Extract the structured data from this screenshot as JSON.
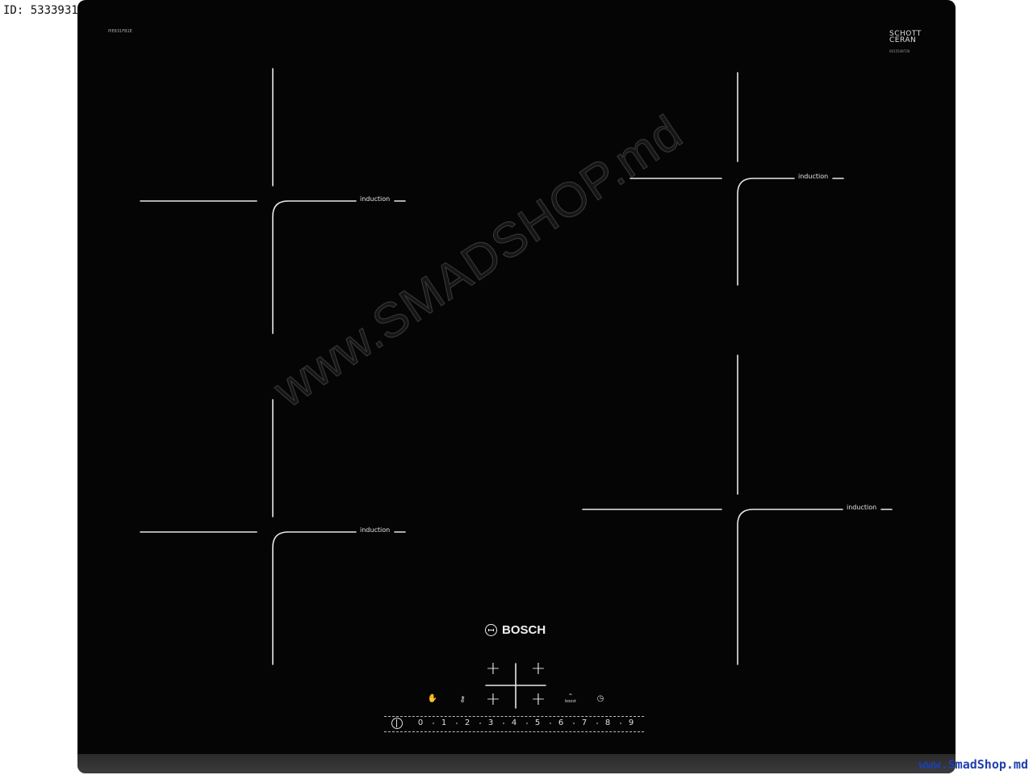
{
  "image_id_label": "ID: 5333931",
  "product": {
    "model_code": "PIE631FB1E",
    "glass_brand_line1": "SCHOTT",
    "glass_brand_line2": "CERAN",
    "glass_code": "0015548726",
    "brand": "BOSCH",
    "zone_label": "induction"
  },
  "controls": {
    "slider_levels": [
      "0",
      "1",
      "2",
      "3",
      "4",
      "5",
      "6",
      "7",
      "8",
      "9"
    ],
    "boost_label": "boost",
    "icons": [
      "power-icon",
      "hand-icon",
      "key-lock-icon",
      "boost-icon",
      "timer-icon",
      "zone-select-plus-icon"
    ]
  },
  "watermark": "www.SMADSHOP.md",
  "site_credit": "www.SmadShop.md",
  "colors": {
    "glass": "#050505",
    "markings": "#e8e8e8",
    "credit": "#1f3fae"
  }
}
